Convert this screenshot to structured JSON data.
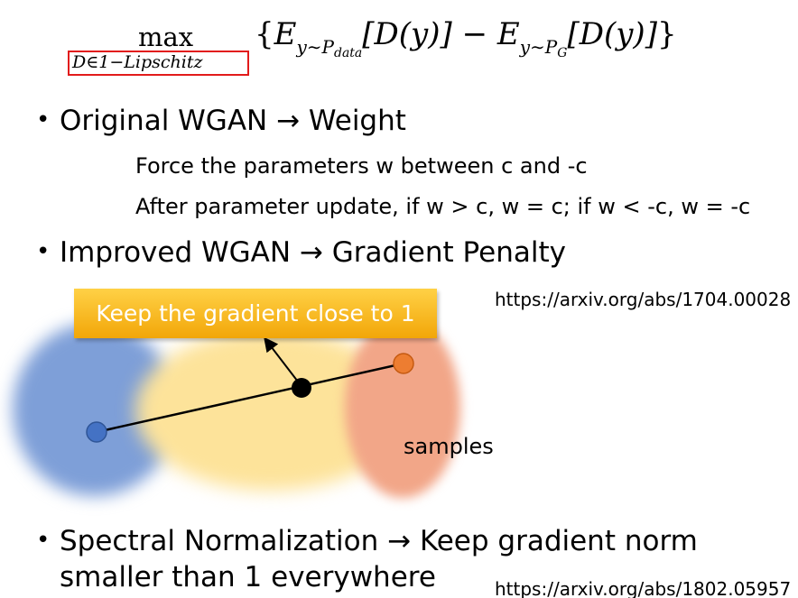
{
  "formula": {
    "max_label": "max",
    "constraint": "D∈1−Lipschitz",
    "brace_open": "{",
    "e1": "E",
    "e1_sub_y": "y∼P",
    "e1_sub_sub": "data",
    "e1_arg": "[D(y)]",
    "minus": " − ",
    "e2": "E",
    "e2_sub_y": "y∼P",
    "e2_sub_sub": "G",
    "e2_arg": "[D(y)]",
    "brace_close": "}",
    "constraint_box_color": "#e21b1b"
  },
  "bullets": [
    {
      "dot": "•",
      "text": "Original WGAN → Weight",
      "sub_lines": [
        "Force the parameters w between c and -c",
        "After parameter update, if w > c, w = c; if w < -c, w = -c"
      ]
    },
    {
      "dot": "•",
      "text": "Improved WGAN → Gradient Penalty",
      "url": "https://arxiv.org/abs/1704.00028"
    },
    {
      "dot": "•",
      "text_line1": "Spectral Normalization → Keep gradient norm",
      "text_line2": "smaller than 1 everywhere",
      "url": "https://arxiv.org/abs/1802.05957"
    }
  ],
  "diagram": {
    "callout_text": "Keep the gradient close to 1",
    "samples_label": "samples",
    "colors": {
      "blue_region": "#7e9fd8",
      "yellow_region": "#fde39a",
      "orange_region": "#f2a688",
      "blue_point": "#4472c4",
      "orange_point": "#ed7d31",
      "callout": "#ffc000"
    }
  }
}
